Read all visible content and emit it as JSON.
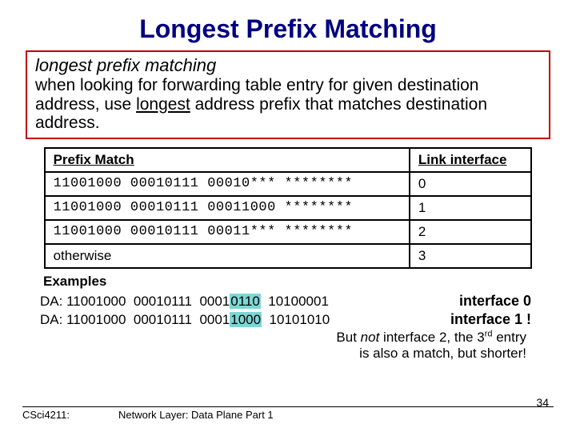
{
  "title": "Longest Prefix Matching",
  "definition": {
    "heading": "longest prefix matching",
    "body_pre": "when looking for forwarding table entry for given destination address, use ",
    "body_emph": "longest",
    "body_post": " address prefix that matches destination address."
  },
  "table": {
    "col1": "Prefix Match",
    "col2": "Link interface",
    "rows": [
      {
        "prefix": "11001000 00010111 00010*** ********",
        "iface": "0"
      },
      {
        "prefix": "11001000 00010111 00011000 ********",
        "iface": "1"
      },
      {
        "prefix": "11001000 00010111 00011*** ********",
        "iface": "2"
      },
      {
        "prefix": "otherwise",
        "iface": "3",
        "plain": true
      }
    ]
  },
  "examples_label": "Examples",
  "examples": [
    {
      "label": "DA: ",
      "pre": "11001000  00010111  0001",
      "hl": "0110",
      "post": "  10100001",
      "answer": "interface 0"
    },
    {
      "label": "DA: ",
      "pre": "11001000  00010111  0001",
      "hl": "1000",
      "post": "  10101010",
      "answer": "interface 1 !"
    }
  ],
  "note": {
    "line1_pre": "But ",
    "line1_ital": "not",
    "line1_post": " interface 2, the 3",
    "line1_sup": "rd",
    "line1_end": " entry",
    "line2": "is also a match, but shorter!"
  },
  "footer": {
    "left": "CSci4211:",
    "center": "Network Layer: Data Plane Part 1",
    "page": "34"
  }
}
